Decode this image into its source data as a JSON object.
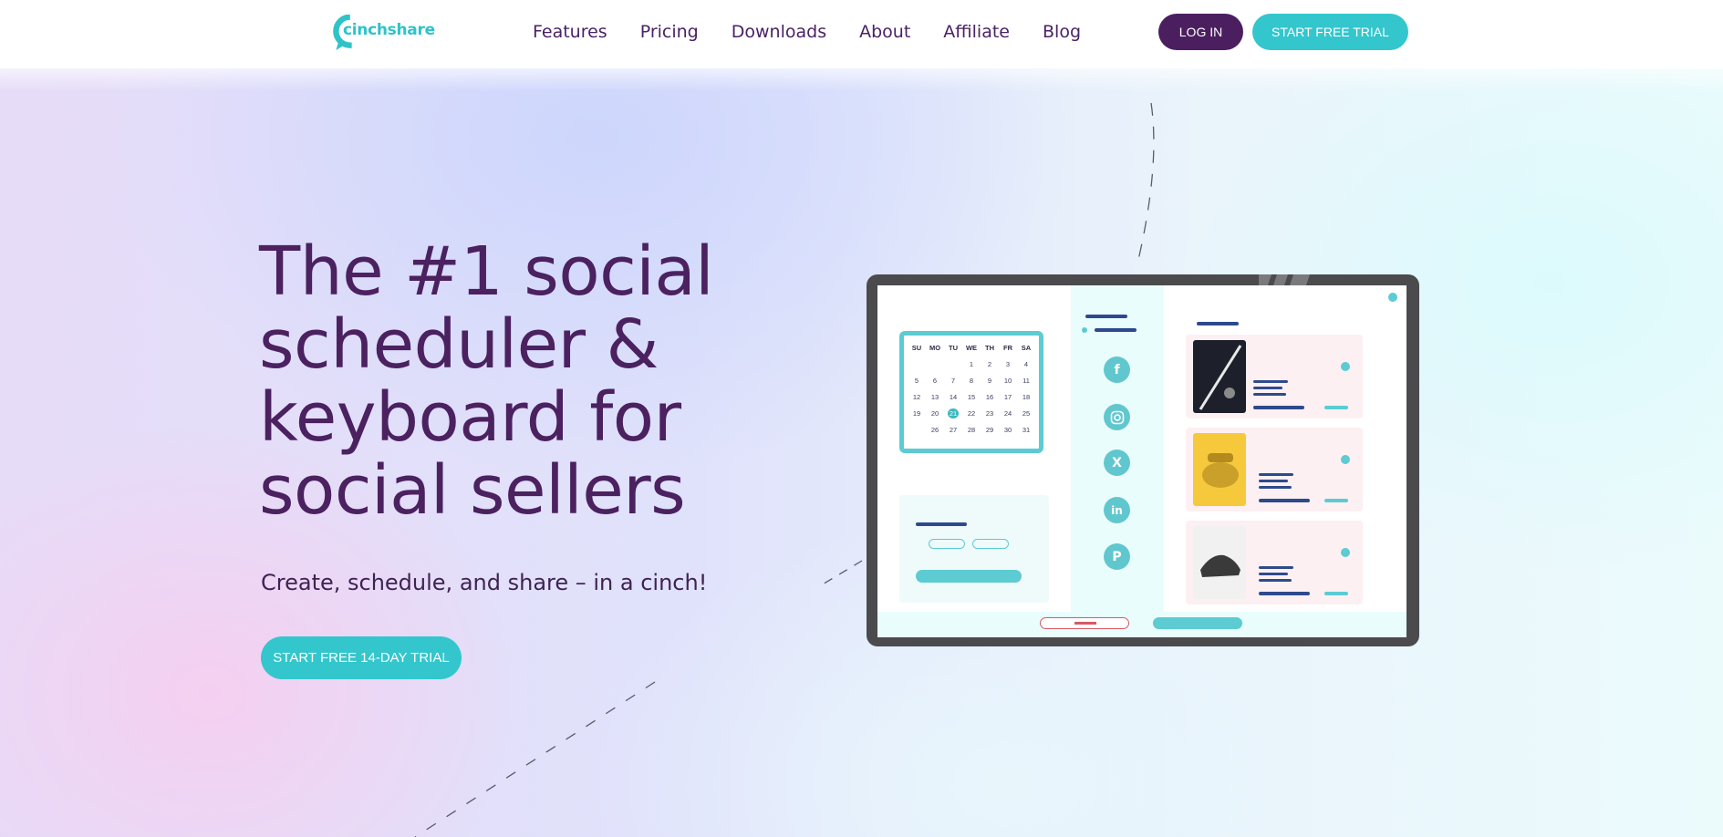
{
  "brand": {
    "name": "cinchshare",
    "color": "#2fc3c9"
  },
  "nav": {
    "items": [
      {
        "label": "Features"
      },
      {
        "label": "Pricing"
      },
      {
        "label": "Downloads"
      },
      {
        "label": "About"
      },
      {
        "label": "Affiliate"
      },
      {
        "label": "Blog"
      }
    ]
  },
  "header": {
    "login_label": "LOG IN",
    "trial_label": "START FREE TRIAL"
  },
  "hero": {
    "headline_lines": [
      "The #1 social",
      "scheduler &",
      "keyboard for",
      "social sellers"
    ],
    "subline": "Create, schedule, and share – in a cinch!",
    "cta_label": "START FREE 14-DAY TRIAL"
  },
  "illustration": {
    "calendar": {
      "days": [
        "SU",
        "MO",
        "TU",
        "WE",
        "TH",
        "FR",
        "SA"
      ],
      "weeks": [
        [
          "",
          "",
          "",
          "1",
          "2",
          "3",
          "4"
        ],
        [
          "5",
          "6",
          "7",
          "8",
          "9",
          "10",
          "11"
        ],
        [
          "12",
          "13",
          "14",
          "15",
          "16",
          "17",
          "18"
        ],
        [
          "19",
          "20",
          "21",
          "22",
          "23",
          "24",
          "25"
        ],
        [
          "",
          "26",
          "27",
          "28",
          "29",
          "30",
          "31"
        ]
      ],
      "highlighted": "21"
    },
    "social_icons": [
      "facebook-icon",
      "instagram-icon",
      "x-icon",
      "linkedin-icon",
      "pinterest-icon"
    ]
  },
  "colors": {
    "primary_purple": "#4b1f5f",
    "accent_teal": "#33c6cd",
    "text_purple": "#4b2160"
  }
}
